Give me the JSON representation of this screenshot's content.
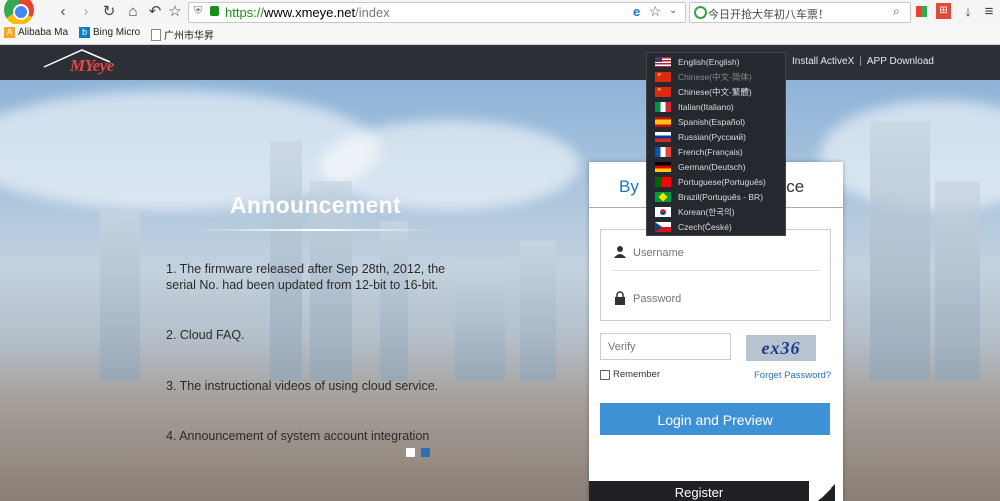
{
  "browser": {
    "url_scheme": "https://",
    "url_host": "www.xmeye.net",
    "url_path": "/index",
    "search_text": "今日开抢大年初八车票！",
    "bookmarks": [
      "Alibaba Ma",
      "Bing Micro",
      "广州市华昇"
    ]
  },
  "site": {
    "logo": "MYeye",
    "header_links": [
      "Install ActiveX",
      "APP Download"
    ]
  },
  "announcement": {
    "title": "Announcement",
    "items": [
      "1. The firmware released after Sep 28th, 2012, the serial No. had been updated from 12-bit to 16-bit.",
      "2. Cloud FAQ.",
      "3. The instructional videos of using cloud service.",
      "4. Announcement of system account integration"
    ]
  },
  "login": {
    "tab_by": "By",
    "tab_device": "vice",
    "username_placeholder": "Username",
    "password_placeholder": "Password",
    "verify_placeholder": "Verify",
    "captcha": "ex36",
    "remember": "Remember",
    "forgot": "Forget Password?",
    "login_button": "Login and Preview",
    "register_button": "Register"
  },
  "languages": [
    {
      "label": "English(English)",
      "flag": "us"
    },
    {
      "label": "Chinese(中文-简体)",
      "flag": "cn",
      "active": true
    },
    {
      "label": "Chinese(中文-繁體)",
      "flag": "cn"
    },
    {
      "label": "Italian(Italiano)",
      "flag": "it"
    },
    {
      "label": "Spanish(Español)",
      "flag": "es"
    },
    {
      "label": "Russian(Русский)",
      "flag": "ru"
    },
    {
      "label": "French(Français)",
      "flag": "fr"
    },
    {
      "label": "German(Deutsch)",
      "flag": "de"
    },
    {
      "label": "Portuguese(Português)",
      "flag": "pt"
    },
    {
      "label": "Brazil(Português - BR)",
      "flag": "br"
    },
    {
      "label": "Korean(한국의)",
      "flag": "kr"
    },
    {
      "label": "Czech(České)",
      "flag": "cz"
    }
  ],
  "colors": {
    "accent": "#3f91d6",
    "header_bg": "#2c2f36",
    "logo_red": "#e84545"
  }
}
